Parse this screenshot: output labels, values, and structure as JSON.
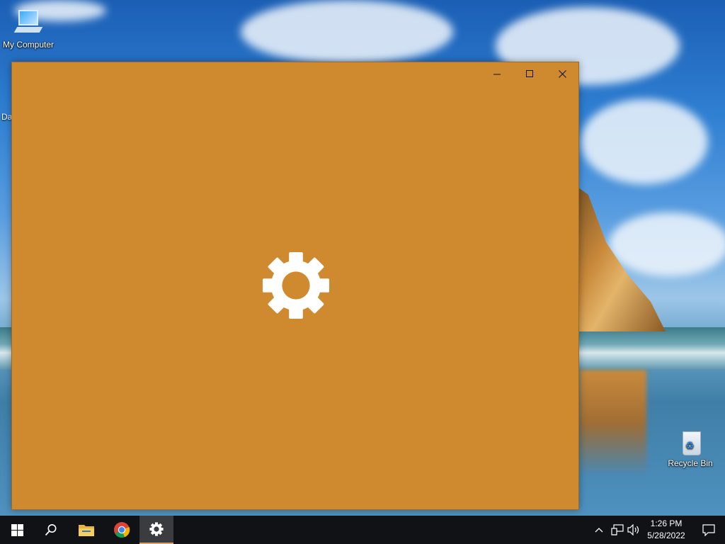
{
  "desktop": {
    "icons": [
      {
        "label": "My Computer",
        "icon": "computer-icon"
      },
      {
        "label": "Recycle Bin",
        "icon": "recycle-bin-icon"
      }
    ],
    "partial_label": "Da"
  },
  "window": {
    "background_color": "#cf8a30",
    "splash_icon": "gear-icon",
    "controls": [
      "minimize-icon",
      "maximize-icon",
      "close-icon"
    ]
  },
  "taskbar": {
    "buttons": [
      {
        "name": "start",
        "icon": "windows-logo-icon"
      },
      {
        "name": "search",
        "icon": "search-icon"
      },
      {
        "name": "file-explorer",
        "icon": "folder-icon"
      },
      {
        "name": "chrome",
        "icon": "chrome-icon"
      },
      {
        "name": "settings",
        "icon": "gear-icon",
        "active": true
      }
    ],
    "tray_icons": [
      "chevron-up-icon",
      "network-icon",
      "volume-icon"
    ],
    "clock": {
      "time": "1:26 PM",
      "date": "5/28/2022"
    },
    "notification_icon": "action-center-icon"
  }
}
